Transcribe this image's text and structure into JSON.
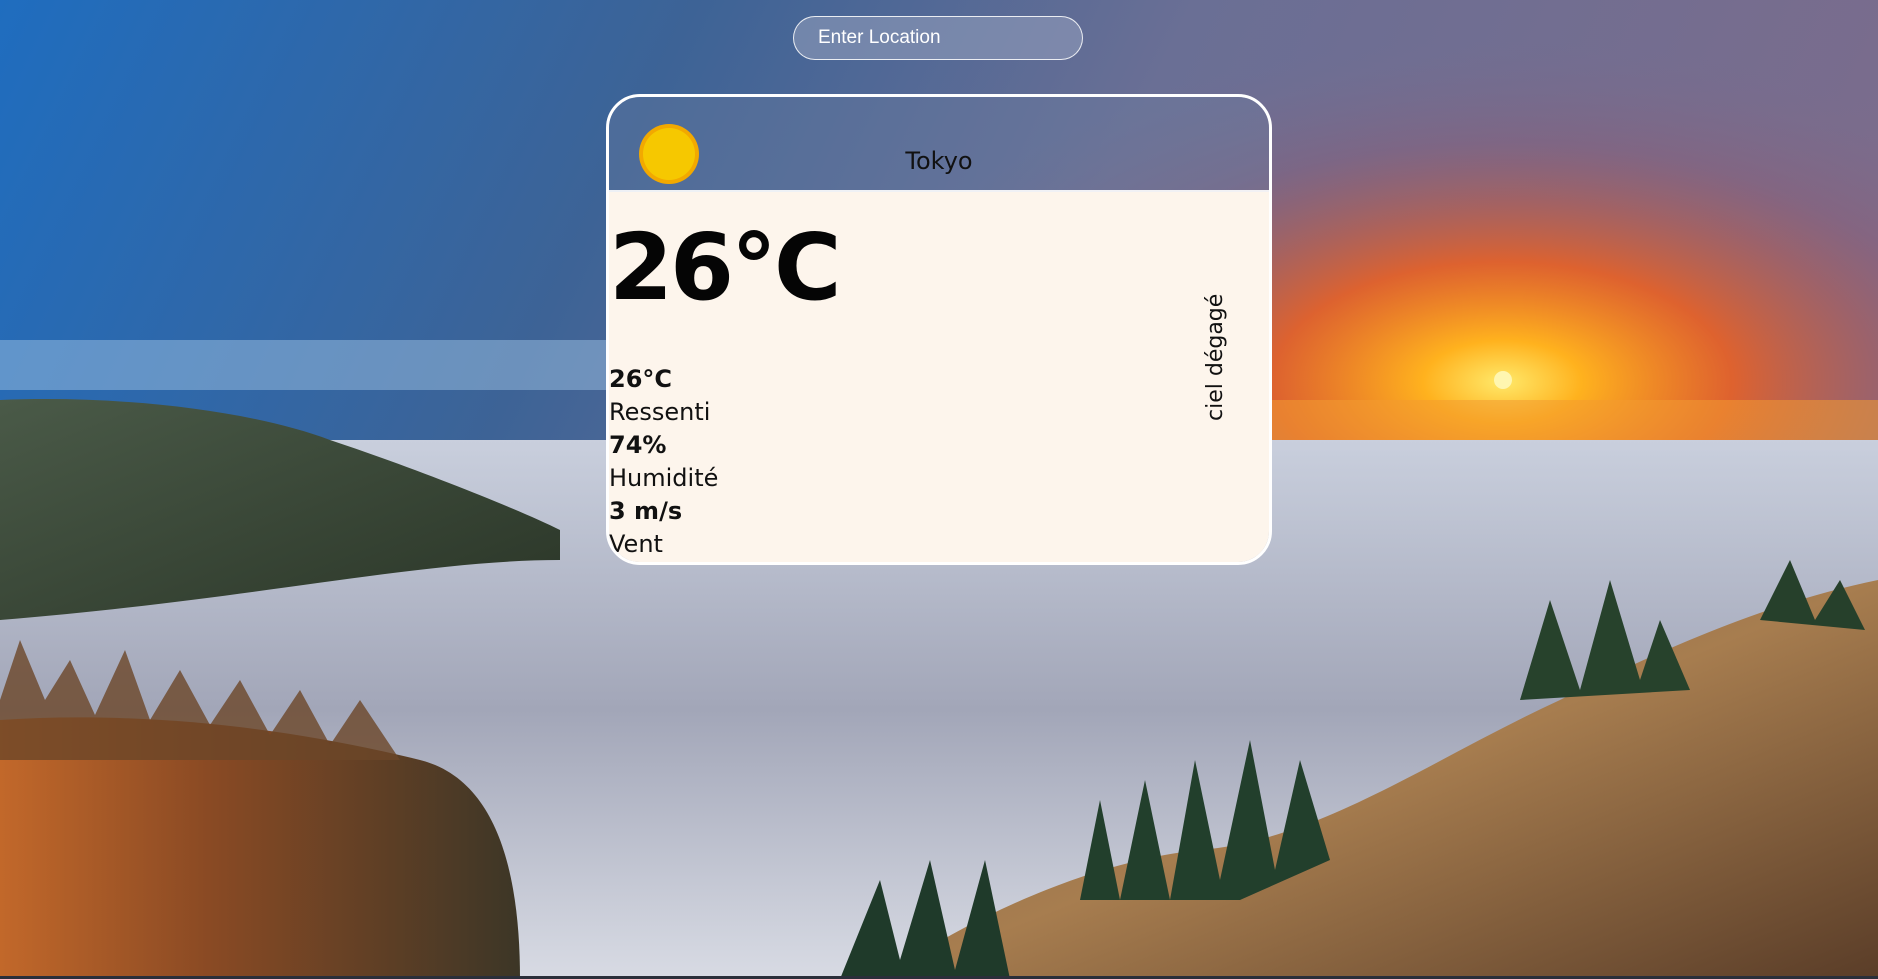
{
  "search": {
    "placeholder": "Enter Location",
    "value": ""
  },
  "weather_card": {
    "icon": "sun-icon",
    "city": "Tokyo",
    "temperature": "26°C",
    "description": "ciel dégagé",
    "stats": [
      {
        "value": "26°C",
        "label": "Ressenti"
      },
      {
        "value": "74%",
        "label": "Humidité"
      },
      {
        "value": "3 m/s",
        "label": "Vent"
      }
    ]
  },
  "colors": {
    "card_body": "#fdf5ec",
    "sun": "#f6c800",
    "sun_ray": "#f2a900"
  }
}
